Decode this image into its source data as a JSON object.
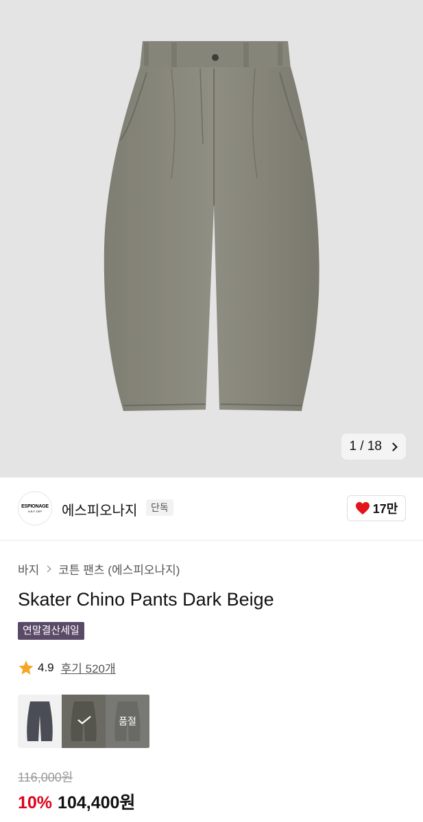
{
  "gallery": {
    "image_alt": "Skater Chino Pants Dark Beige product photo",
    "current_index": "1",
    "separator": "/",
    "total": "18"
  },
  "brand": {
    "logo_line1": "ESPIONAGE",
    "logo_line2": "N.B.F. DEP",
    "name": "에스피오나지",
    "exclusive_label": "단독",
    "like_count": "17만"
  },
  "breadcrumb": {
    "category": "바지",
    "subcategory": "코튼 팬츠 (에스피오나지)"
  },
  "product": {
    "title": "Skater Chino Pants Dark Beige",
    "sale_badge": "연말결산세일",
    "rating": "4.9",
    "reviews_label": "후기 520개"
  },
  "color_options": [
    {
      "name": "charcoal",
      "color": "#4a4d55",
      "selected": false,
      "sold_out": false
    },
    {
      "name": "dark-beige",
      "color": "#6b6b63",
      "selected": true,
      "sold_out": false
    },
    {
      "name": "khaki",
      "color": "#7e7f77",
      "selected": false,
      "sold_out": true,
      "sold_out_label": "품절"
    }
  ],
  "pricing": {
    "original_price": "116,000원",
    "discount": "10%",
    "sale_price": "104,400원"
  },
  "colors": {
    "accent_red": "#e0001b",
    "badge_purple": "#5a4a68",
    "heart": "#e3141b",
    "star": "#f5a623",
    "pants": "#8b8a7f"
  }
}
